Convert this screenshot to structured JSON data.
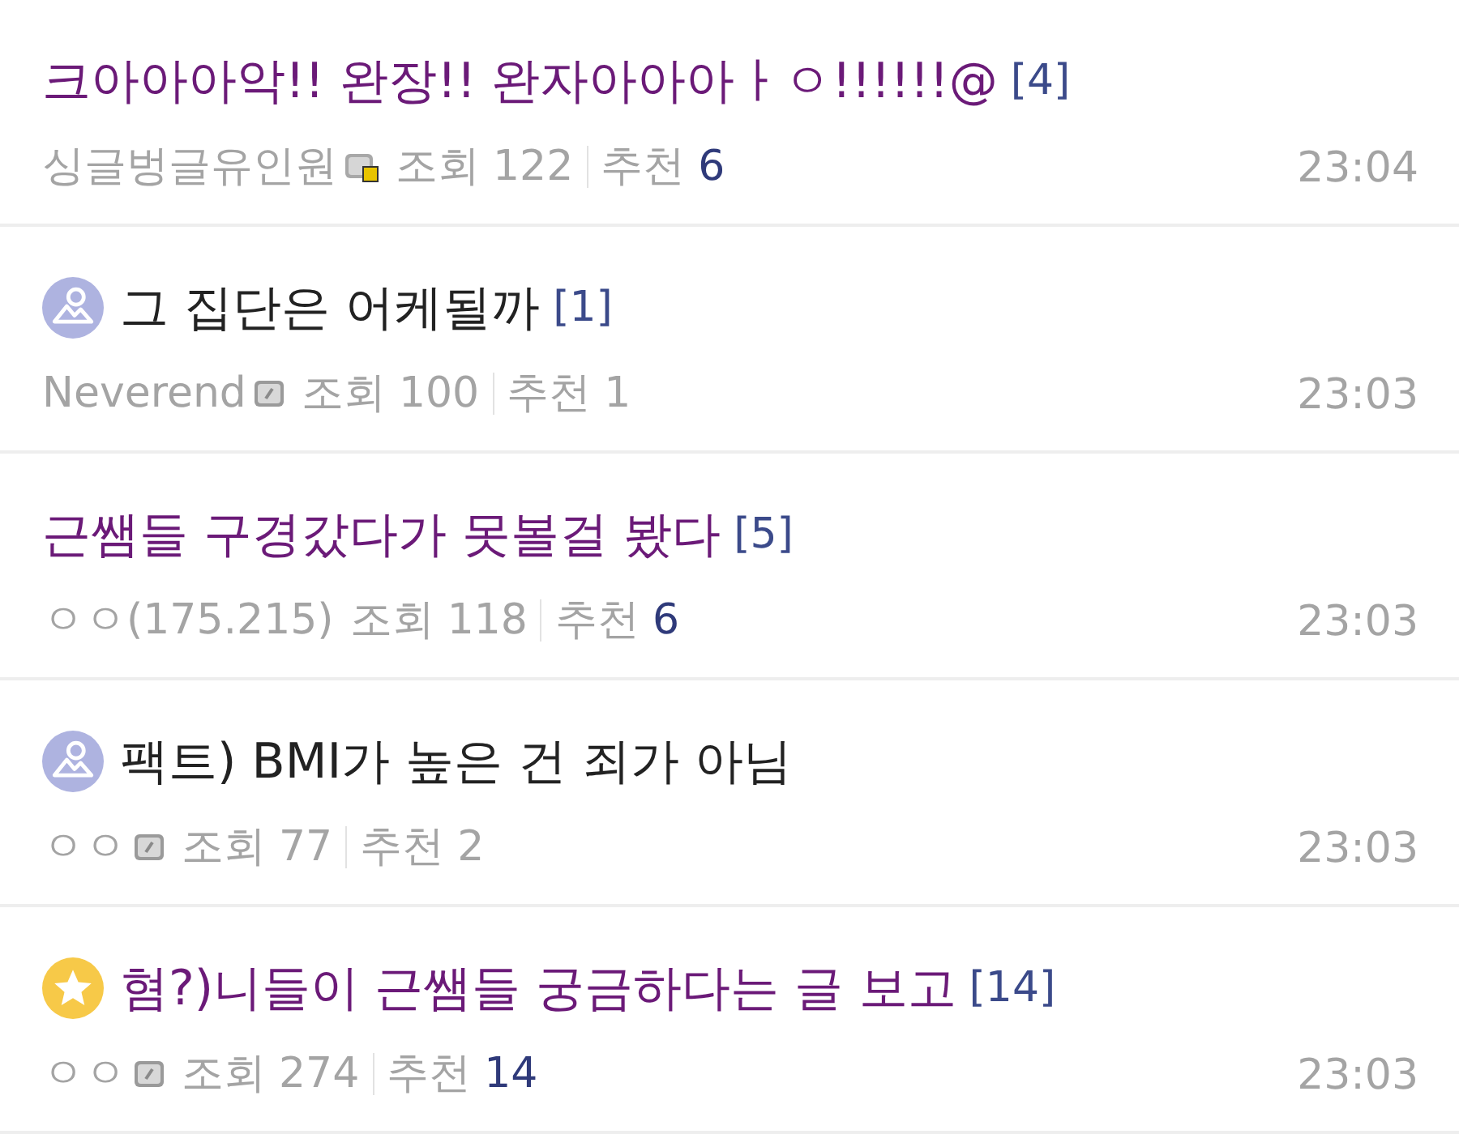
{
  "posts": [
    {
      "kind": "text",
      "title": "크아아아악!! 완장!! 완자아아아ㅏㅇ!!!!!!@",
      "comments": "[4]",
      "visited": true,
      "author": {
        "kind": "fixed",
        "name": "싱글벙글유인원"
      },
      "views_label": "조회",
      "views": "122",
      "recommend_label": "추천",
      "recommend": "6",
      "recommend_highlighted": true,
      "time": "23:04"
    },
    {
      "kind": "image",
      "title": "그 집단은 어케될까",
      "comments": "[1]",
      "visited": false,
      "author": {
        "kind": "member",
        "name": "Neverend"
      },
      "views_label": "조회",
      "views": "100",
      "recommend_label": "추천",
      "recommend": "1",
      "recommend_highlighted": false,
      "time": "23:03"
    },
    {
      "kind": "text",
      "title": "근쌤들 구경갔다가 못볼걸 봤다",
      "comments": "[5]",
      "visited": true,
      "author": {
        "kind": "guest",
        "name": "ㅇㅇ(175.215)"
      },
      "views_label": "조회",
      "views": "118",
      "recommend_label": "추천",
      "recommend": "6",
      "recommend_highlighted": true,
      "time": "23:03"
    },
    {
      "kind": "image",
      "title": "팩트) BMI가 높은 건 죄가 아님",
      "visited": false,
      "author": {
        "kind": "member",
        "name": "ㅇㅇ"
      },
      "views_label": "조회",
      "views": "77",
      "recommend_label": "추천",
      "recommend": "2",
      "recommend_highlighted": false,
      "time": "23:03"
    },
    {
      "kind": "featured",
      "title": "혐?)니들이 근쌤들 궁금하다는 글 보고",
      "comments": "[14]",
      "visited": true,
      "author": {
        "kind": "member",
        "name": "ㅇㅇ"
      },
      "views_label": "조회",
      "views": "274",
      "recommend_label": "추천",
      "recommend": "14",
      "recommend_highlighted": true,
      "time": "23:03"
    }
  ]
}
